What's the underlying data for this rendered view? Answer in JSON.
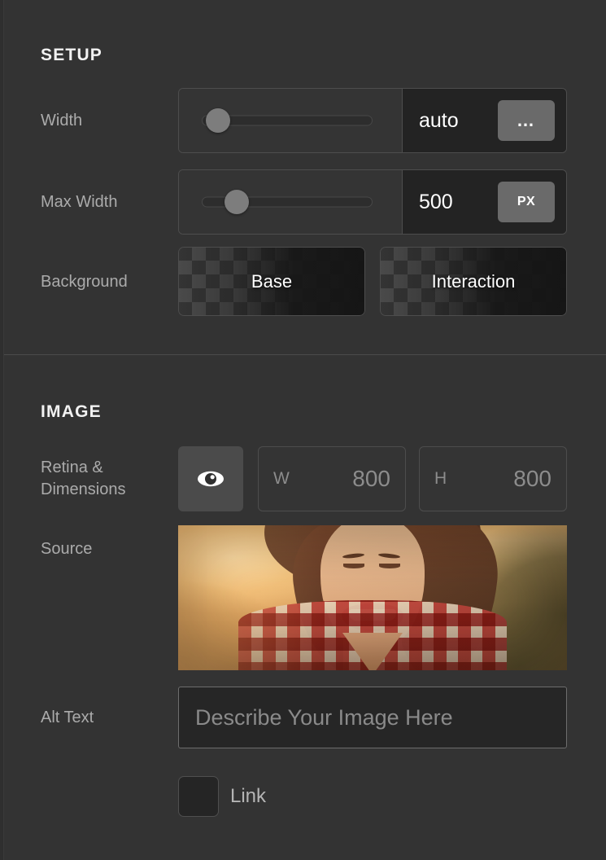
{
  "panel": {
    "sections": [
      {
        "title": "SETUP",
        "rows": {
          "width": {
            "label": "Width",
            "value": "auto",
            "unit": "…",
            "unit_icon": "ellipsis-icon",
            "slider_percent": 6
          },
          "max_width": {
            "label": "Max Width",
            "value": "500",
            "unit": "PX",
            "slider_percent": 14
          },
          "background": {
            "label": "Background",
            "swatches": [
              {
                "label": "Base"
              },
              {
                "label": "Interaction"
              }
            ]
          }
        }
      },
      {
        "title": "IMAGE",
        "rows": {
          "retina": {
            "label": "Retina &\nDimensions",
            "label_line1": "Retina &",
            "label_line2": "Dimensions",
            "eye_icon": "eye-icon",
            "width_field": {
              "prefix": "W",
              "value": "800"
            },
            "height_field": {
              "prefix": "H",
              "value": "800"
            }
          },
          "source": {
            "label": "Source",
            "image_alt": "smiling woman wearing hat and plaid shirt at sunset"
          },
          "alt_text": {
            "label": "Alt Text",
            "placeholder": "Describe Your Image Here",
            "value": ""
          },
          "link": {
            "label": "Link",
            "checked": false
          }
        }
      }
    ]
  },
  "colors": {
    "panel_bg": "#333333",
    "field_bg": "#343434",
    "value_bg": "#232323",
    "border": "#4d4d4d",
    "label_text": "#ababab",
    "value_text": "#ffffff",
    "muted_text": "#8c8c8c",
    "unit_button": "#6a6a6a"
  }
}
